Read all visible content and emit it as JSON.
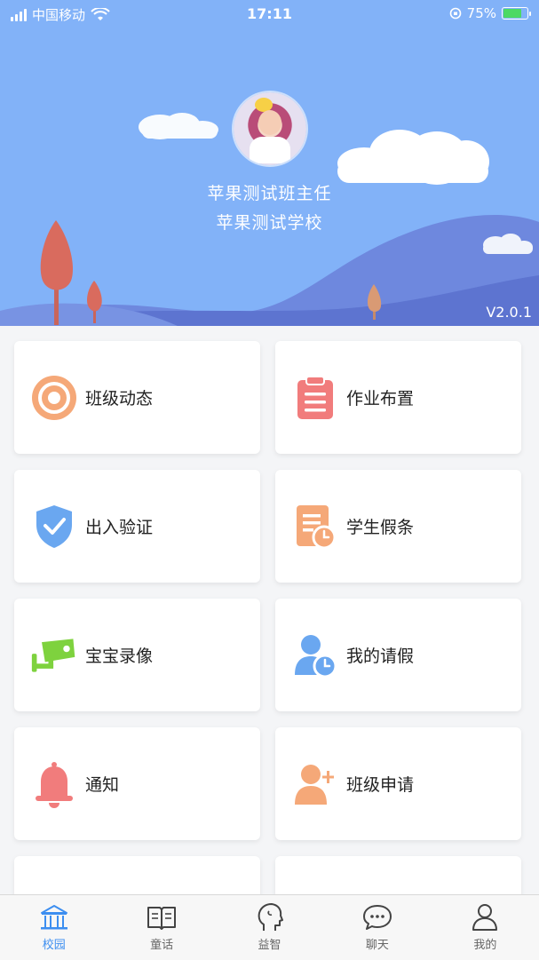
{
  "status_bar": {
    "carrier": "中国移动",
    "time": "17:11",
    "battery": "75%"
  },
  "profile": {
    "name": "苹果测试班主任",
    "school": "苹果测试学校"
  },
  "version": "V2.0.1",
  "menu": [
    {
      "label": "班级动态",
      "icon": "class-news-icon"
    },
    {
      "label": "作业布置",
      "icon": "homework-icon"
    },
    {
      "label": "出入验证",
      "icon": "shield-check-icon"
    },
    {
      "label": "学生假条",
      "icon": "student-leave-icon"
    },
    {
      "label": "宝宝录像",
      "icon": "camera-icon"
    },
    {
      "label": "我的请假",
      "icon": "my-leave-icon"
    },
    {
      "label": "通知",
      "icon": "bell-icon"
    },
    {
      "label": "班级申请",
      "icon": "add-user-icon"
    }
  ],
  "tabs": [
    {
      "label": "校园",
      "icon": "school-icon",
      "active": true
    },
    {
      "label": "童话",
      "icon": "book-icon",
      "active": false
    },
    {
      "label": "益智",
      "icon": "head-icon",
      "active": false
    },
    {
      "label": "聊天",
      "icon": "chat-icon",
      "active": false
    },
    {
      "label": "我的",
      "icon": "person-icon",
      "active": false
    }
  ],
  "colors": {
    "header_bg": "#82b2f8",
    "accent": "#3c8ef0",
    "orange": "#f5a878",
    "red": "#f17c7c",
    "blue": "#6aa7f0",
    "green": "#7ed23e"
  }
}
